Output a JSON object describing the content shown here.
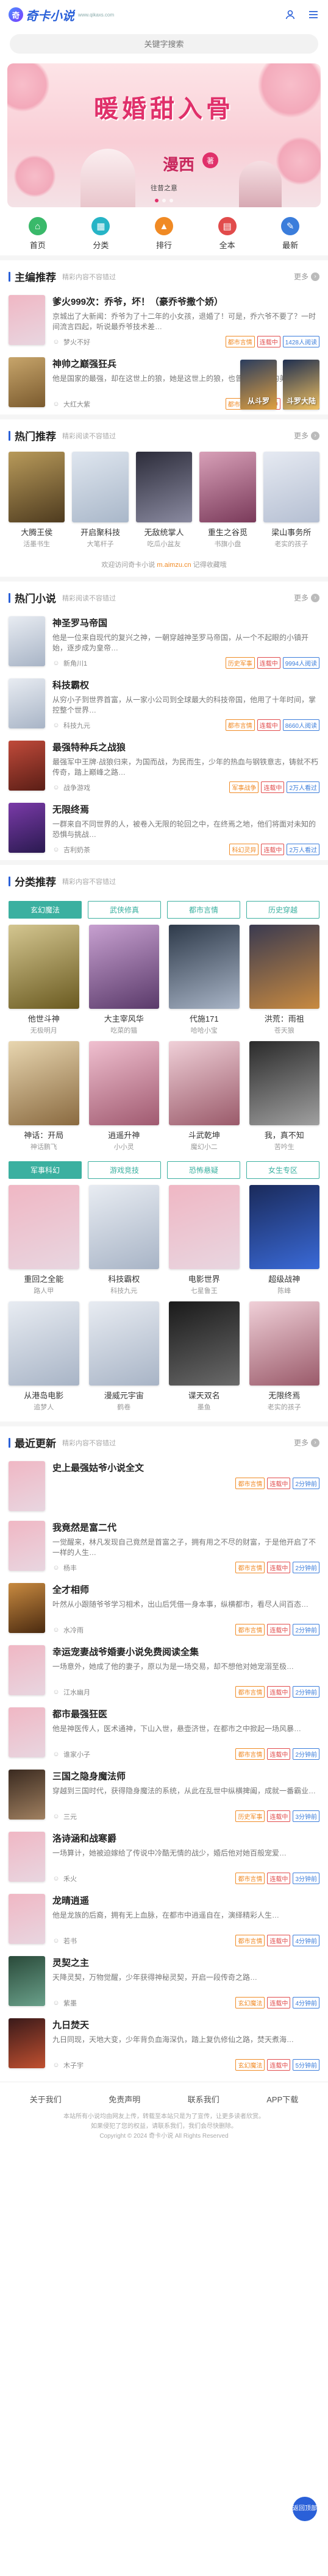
{
  "header": {
    "logo_mark": "奇",
    "logo_text": "奇卡小说",
    "logo_sub": "www.qikaxs.com",
    "user_icon": "user-icon",
    "menu_icon": "menu-icon"
  },
  "search": {
    "placeholder": "关键字搜索"
  },
  "banner": {
    "title": "暖婚甜入骨",
    "author": "漫西",
    "badge": "著",
    "caption": "往昔之意"
  },
  "nav": [
    {
      "label": "首页",
      "icon": "home-icon",
      "glyph": "⌂",
      "color": "#3ab96a"
    },
    {
      "label": "分类",
      "icon": "category-icon",
      "glyph": "▦",
      "color": "#27b4c6"
    },
    {
      "label": "排行",
      "icon": "rank-icon",
      "glyph": "▲",
      "color": "#f08a24"
    },
    {
      "label": "全本",
      "icon": "book-icon",
      "glyph": "▤",
      "color": "#e14b4b"
    },
    {
      "label": "最新",
      "icon": "new-icon",
      "glyph": "✎",
      "color": "#3b7ddb"
    }
  ],
  "sections": {
    "recommend": {
      "title": "主编推荐",
      "sub": "精彩内容不容错过",
      "more": "更多"
    },
    "popular": {
      "title": "热门推荐",
      "sub": "精彩阅读不容错过",
      "more": "更多"
    },
    "hot": {
      "title": "热门小说",
      "sub": "精彩阅读不容错过",
      "more": "更多"
    },
    "category": {
      "title": "分类推荐",
      "sub": "精彩内容不容错过"
    },
    "latest": {
      "title": "最近更新",
      "sub": "精彩内容不容错过",
      "more": "更多"
    }
  },
  "recommend_list": [
    {
      "title": "爹火999次：乔爷，坏！（豪乔爷撒个娇）",
      "desc": "京城出了大新闻：乔爷为了十二年的小女孩，退婚了！可是，乔六爷不要了？一时间流言四起，听说最乔爷技术差…",
      "author": "梦火不好",
      "tags": [
        "都市言情",
        "连载中",
        "1428人阅读"
      ],
      "colors": [
        "#f0b7c4",
        "#e8d6e0"
      ]
    },
    {
      "title": "神帅之巅强狂兵",
      "desc": "他是国家的最强，却在这世上的狼，她是这世上的狼，也曾想要过往的美好…",
      "author": "大红大紫",
      "tags": [
        "都市言情",
        "连载中",
        "1098人阅读"
      ],
      "colors": [
        "#c7a56b",
        "#7a5a2e"
      ]
    }
  ],
  "recommend_side": [
    {
      "name": "从斗罗",
      "colors": [
        "#2b3d5e",
        "#e0a040"
      ]
    },
    {
      "name": "斗罗大陆",
      "colors": [
        "#1f2f50",
        "#f0c060"
      ]
    }
  ],
  "popular_list": [
    {
      "name": "大腾王侯",
      "author": "活墨书生",
      "colors": [
        "#b89a5a",
        "#4e3b1f"
      ]
    },
    {
      "name": "开启聚科技",
      "author": "大笔杆子",
      "colors": [
        "#dfe6ef",
        "#a9b7c9"
      ]
    },
    {
      "name": "无敌统掌人",
      "author": "吃瓜小盆友",
      "colors": [
        "#2c2c3a",
        "#8a8aa0"
      ]
    },
    {
      "name": "重生之谷觅",
      "author": "书旗小盘",
      "colors": [
        "#d8a0b8",
        "#7a3a5a"
      ]
    },
    {
      "name": "梁山事务所",
      "author": "老实的孩子",
      "colors": [
        "#e6eaf2",
        "#b5bfd2"
      ]
    }
  ],
  "notice": {
    "pre": "欢迎访问奇卡小说 ",
    "site": "m.aimzu.cn",
    "post": " 记得收藏哦"
  },
  "hot_list": [
    {
      "title": "神圣罗马帝国",
      "desc": "他是一位来自现代的复兴之神，一朝穿越神圣罗马帝国，从一个不起眼的小镇开始，逐步成为皇帝…",
      "author": "新角川1",
      "tags": [
        "历史军事",
        "连载中",
        "9994人阅读"
      ],
      "colors": [
        "#e8ecf2",
        "#a8b4c6"
      ]
    },
    {
      "title": "科技霸权",
      "desc": "从穷小子到世界首富，从一家小公司到全球最大的科技帝国，他用了十年时间，掌控整个世界…",
      "author": "科技九元",
      "tags": [
        "都市言情",
        "连载中",
        "8660人阅读"
      ],
      "colors": [
        "#e8ecf2",
        "#a8b4c6"
      ]
    },
    {
      "title": "最强特种兵之战狼",
      "desc": "最强军中王牌·战狼归来，为国而战，为民而生，少年的热血与钢铁意志，铸就不朽传奇，踏上巅峰之路…",
      "author": "战争游戏",
      "tags": [
        "军事战争",
        "连载中",
        "2万人看过"
      ],
      "colors": [
        "#c04a3a",
        "#5a1e16"
      ]
    },
    {
      "title": "无限终焉",
      "desc": "一群来自不同世界的人，被卷入无限的轮回之中，在终焉之地，他们将面对未知的恐惧与挑战…",
      "author": "吉利奶茶",
      "tags": [
        "科幻灵异",
        "连载中",
        "2万人看过"
      ],
      "colors": [
        "#7a3aa8",
        "#2a1a50"
      ]
    }
  ],
  "cat_tabs_1": [
    "玄幻魔法",
    "武侠修真",
    "都市言情",
    "历史穿越"
  ],
  "cat_grid_1": [
    {
      "name": "他世斗神",
      "author": "无极明月",
      "colors": [
        "#d4c690",
        "#6a5a20"
      ]
    },
    {
      "name": "大主宰风华",
      "author": "吃菜的猫",
      "colors": [
        "#c7a0d0",
        "#5a3a6a"
      ]
    },
    {
      "name": "代施171",
      "author": "哈哈小宝",
      "colors": [
        "#2e3a4a",
        "#a8b4c6"
      ]
    },
    {
      "name": "洪荒：雨祖",
      "author": "苍天狼",
      "colors": [
        "#3a3a50",
        "#c88a40"
      ]
    },
    {
      "name": "神话：开局",
      "author": "神话鹏飞",
      "colors": [
        "#e8d6b0",
        "#8a6a40"
      ]
    },
    {
      "name": "逍遥升神",
      "author": "小小灵",
      "colors": [
        "#f0c0d0",
        "#a05a70"
      ]
    },
    {
      "name": "斗武乾坤",
      "author": "魔幻小二",
      "colors": [
        "#f0d0d8",
        "#9a5a6a"
      ]
    },
    {
      "name": "我，真不知",
      "author": "苦吟生",
      "colors": [
        "#2a2a2a",
        "#a0a0a0"
      ]
    }
  ],
  "cat_tabs_2": [
    "军事科幻",
    "游戏竞技",
    "恐怖悬疑",
    "女生专区"
  ],
  "cat_grid_2": [
    {
      "name": "重回之全能",
      "author": "路人甲",
      "colors": [
        "#f0b7c4",
        "#e8d6e0"
      ]
    },
    {
      "name": "科技霸权",
      "author": "科技九元",
      "colors": [
        "#e8ecf2",
        "#a8b4c6"
      ]
    },
    {
      "name": "电影世界",
      "author": "七星鲁王",
      "colors": [
        "#f0b7c4",
        "#e8d6e0"
      ]
    },
    {
      "name": "超级战神",
      "author": "陈峰",
      "colors": [
        "#1a2a5a",
        "#3a6ad8"
      ]
    },
    {
      "name": "从港岛电影",
      "author": "追梦人",
      "colors": [
        "#e8ecf2",
        "#a8b4c6"
      ]
    },
    {
      "name": "漫威元宇宙",
      "author": "鹤卷",
      "colors": [
        "#e8ecf2",
        "#a8b4c6"
      ]
    },
    {
      "name": "谍天双名",
      "author": "墨鱼",
      "colors": [
        "#1a1a1a",
        "#6a6a6a"
      ]
    },
    {
      "name": "无限终焉",
      "author": "老实的孩子",
      "colors": [
        "#f0d0d8",
        "#9a5a6a"
      ]
    }
  ],
  "latest_list": [
    {
      "title": "史上最强姑爷小说全文",
      "desc": "",
      "author": "",
      "tags": [
        "都市言情",
        "连载中",
        "2分钟前"
      ],
      "colors": [
        "#f0b7c4",
        "#e8d6e0"
      ]
    },
    {
      "title": "我竟然是富二代",
      "desc": "一觉醒来，林凡发现自己竟然是首富之子，拥有用之不尽的财富，于是他开启了不一样的人生…",
      "author": "杨丰",
      "tags": [
        "都市言情",
        "连载中",
        "2分钟前"
      ],
      "colors": [
        "#f0b7c4",
        "#e8d6e0"
      ]
    },
    {
      "title": "全才相师",
      "desc": "叶然从小跟随爷爷学习相术，出山后凭借一身本事，纵横都市，看尽人间百态…",
      "author": "水冷雨",
      "tags": [
        "都市言情",
        "连载中",
        "2分钟前"
      ],
      "colors": [
        "#c88a40",
        "#4a2a10"
      ]
    },
    {
      "title": "幸运宠妻战爷婚妻小说免费阅读全集",
      "desc": "一场意外，她成了他的妻子，原以为是一场交易，却不想他对她宠溺至极…",
      "author": "江水幽月",
      "tags": [
        "都市言情",
        "连载中",
        "2分钟前"
      ],
      "colors": [
        "#f0b7c4",
        "#e8d6e0"
      ]
    },
    {
      "title": "都市最强狂医",
      "desc": "他是神医传人，医术通神，下山入世，悬壶济世，在都市之中掀起一场风暴…",
      "author": "谁家小子",
      "tags": [
        "都市言情",
        "连载中",
        "2分钟前"
      ],
      "colors": [
        "#f0b7c4",
        "#e8d6e0"
      ]
    },
    {
      "title": "三国之隐身魔法师",
      "desc": "穿越到三国时代，获得隐身魔法的系统，从此在乱世中纵横捭阖，成就一番霸业…",
      "author": "三元",
      "tags": [
        "历史军事",
        "连载中",
        "3分钟前"
      ],
      "colors": [
        "#3a2a20",
        "#a08060"
      ]
    },
    {
      "title": "洛诗涵和战寒爵",
      "desc": "一场算计，她被迫嫁给了传说中冷酷无情的战少，婚后他对她百般宠爱…",
      "author": "禾火",
      "tags": [
        "都市言情",
        "连载中",
        "3分钟前"
      ],
      "colors": [
        "#f0b7c4",
        "#e8d6e0"
      ]
    },
    {
      "title": "龙晴逍遥",
      "desc": "他是龙族的后裔，拥有无上血脉，在都市中逍遥自在，演绎精彩人生…",
      "author": "若书",
      "tags": [
        "都市言情",
        "连载中",
        "4分钟前"
      ],
      "colors": [
        "#f0b7c4",
        "#e8d6e0"
      ]
    },
    {
      "title": "灵契之主",
      "desc": "天降灵契，万物觉醒，少年获得神秘灵契，开启一段传奇之路…",
      "author": "紫墨",
      "tags": [
        "玄幻魔法",
        "连载中",
        "4分钟前"
      ],
      "colors": [
        "#2a4a3a",
        "#6aa08a"
      ]
    },
    {
      "title": "九日焚天",
      "desc": "九日同现，天地大变，少年背负血海深仇，踏上复仇修仙之路，焚天煮海…",
      "author": "木子宇",
      "tags": [
        "玄幻魔法",
        "连载中",
        "5分钟前"
      ],
      "colors": [
        "#3a1a1a",
        "#c05030"
      ]
    }
  ],
  "footer": {
    "links": [
      "关于我们",
      "免责声明",
      "联系我们",
      "APP下载"
    ],
    "text1": "本站所有小说均由网友上传，转载至本站只是为了宣传，让更多读者欣赏。",
    "text2": "如果侵犯了您的权益，请联系我们，我们会尽快删除。",
    "text3": "Copyright © 2024 奇卡小说 All Rights Reserved",
    "back_top": "返回顶部"
  }
}
